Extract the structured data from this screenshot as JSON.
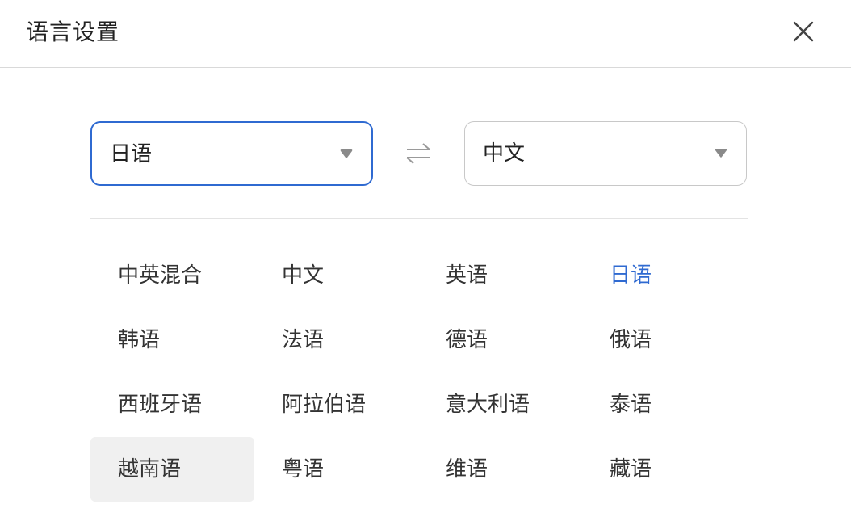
{
  "dialog": {
    "title": "语言设置",
    "close_icon": "close-icon"
  },
  "source_select": {
    "value": "日语",
    "icon": "caret-down-icon"
  },
  "swap": {
    "icon": "swap-arrows-icon"
  },
  "target_select": {
    "value": "中文",
    "icon": "caret-down-icon"
  },
  "colors": {
    "accent": "#2f6ad1",
    "hover_bg": "#f0f0f0",
    "divider": "#e3e3e3"
  },
  "languages": [
    {
      "label": "中英混合",
      "state": ""
    },
    {
      "label": "中文",
      "state": ""
    },
    {
      "label": "英语",
      "state": ""
    },
    {
      "label": "日语",
      "state": "active"
    },
    {
      "label": "韩语",
      "state": ""
    },
    {
      "label": "法语",
      "state": ""
    },
    {
      "label": "德语",
      "state": ""
    },
    {
      "label": "俄语",
      "state": ""
    },
    {
      "label": "西班牙语",
      "state": ""
    },
    {
      "label": "阿拉伯语",
      "state": ""
    },
    {
      "label": "意大利语",
      "state": ""
    },
    {
      "label": "泰语",
      "state": ""
    },
    {
      "label": "越南语",
      "state": "hover"
    },
    {
      "label": "粤语",
      "state": ""
    },
    {
      "label": "维语",
      "state": ""
    },
    {
      "label": "藏语",
      "state": ""
    }
  ]
}
